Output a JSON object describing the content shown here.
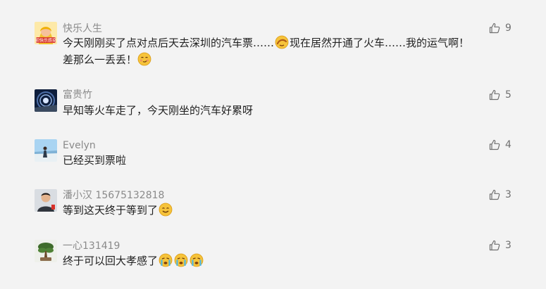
{
  "comments": [
    {
      "user": "快乐人生",
      "likes": "9",
      "line1": [
        "今天刚刚买了点对点后天去深圳的汽车票……",
        "现在居然开通了火车……我的运气啊！"
      ],
      "line2": [
        "差那么一丢丢！"
      ],
      "emojis": [
        "facepalm-emoji",
        "smirk-emoji"
      ],
      "avatar_badge": "把快乐感染"
    },
    {
      "user": "富贵竹",
      "likes": "5",
      "line1": [
        "早知等火车走了，今天刚坐的汽车好累呀"
      ]
    },
    {
      "user": "Evelyn",
      "likes": "4",
      "line1": [
        "已经买到票啦"
      ]
    },
    {
      "user": "潘小汉 15675132818",
      "likes": "3",
      "line1": [
        "等到这天终于等到了"
      ],
      "emojis": [
        "smile-emoji"
      ]
    },
    {
      "user": "一心131419",
      "likes": "3",
      "line1": [
        "终于可以回大孝感了"
      ],
      "emojis": [
        "crying-emoji",
        "crying-emoji",
        "crying-emoji"
      ]
    }
  ],
  "icons": {
    "like": "thumbs-up-icon"
  },
  "colors": {
    "background": "#f3f3f3",
    "name": "#8a8a8a",
    "text": "#222222",
    "like": "#707070"
  }
}
